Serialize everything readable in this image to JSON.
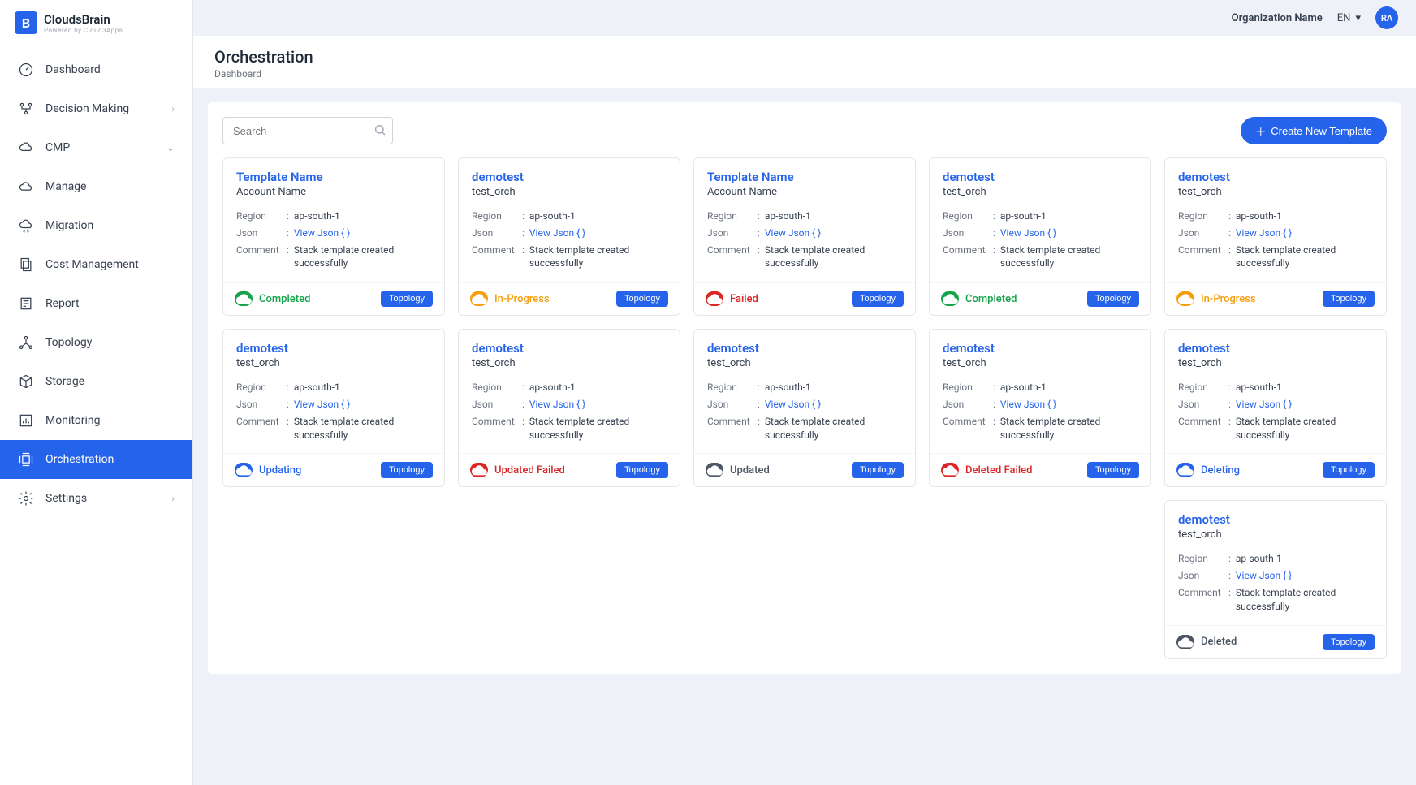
{
  "brand": {
    "name": "CloudsBrain",
    "tagline": "Powered by Cloud3Apps"
  },
  "topbar": {
    "org": "Organization Name",
    "lang": "EN",
    "avatar": "RA"
  },
  "sidebar": {
    "items": [
      {
        "label": "Dashboard",
        "icon": "gauge",
        "expand": null
      },
      {
        "label": "Decision Making",
        "icon": "branch",
        "expand": "right"
      },
      {
        "label": "CMP",
        "icon": "cloud-ring",
        "expand": "down"
      },
      {
        "label": "Manage",
        "icon": "cloud",
        "expand": null
      },
      {
        "label": "Migration",
        "icon": "cloud-arrows",
        "expand": null
      },
      {
        "label": "Cost Management",
        "icon": "docs",
        "expand": null
      },
      {
        "label": "Report",
        "icon": "report",
        "expand": null
      },
      {
        "label": "Topology",
        "icon": "network",
        "expand": null
      },
      {
        "label": "Storage",
        "icon": "box",
        "expand": null
      },
      {
        "label": "Monitoring",
        "icon": "bars",
        "expand": null
      },
      {
        "label": "Orchestration",
        "icon": "frame",
        "expand": null,
        "active": true
      },
      {
        "label": "Settings",
        "icon": "gear",
        "expand": "right"
      }
    ]
  },
  "page": {
    "title": "Orchestration",
    "breadcrumb": "Dashboard"
  },
  "search": {
    "placeholder": "Search"
  },
  "actions": {
    "create": "Create New Template"
  },
  "labels": {
    "region": "Region",
    "json": "Json",
    "comment": "Comment",
    "view_json": "View Json { }",
    "topology": "Topology",
    "sep": ":"
  },
  "cards": [
    {
      "title": "Template Name",
      "account": "Account Name",
      "region": "ap-south-1",
      "comment": "Stack template created successfully",
      "status": "Completed",
      "status_class": "s-completed",
      "icon": "check"
    },
    {
      "title": "demotest",
      "account": "test_orch",
      "region": "ap-south-1",
      "comment": "Stack template created successfully",
      "status": "In-Progress",
      "status_class": "s-inprogress",
      "icon": "sync"
    },
    {
      "title": "Template Name",
      "account": "Account Name",
      "region": "ap-south-1",
      "comment": "Stack template created successfully",
      "status": "Failed",
      "status_class": "s-failed",
      "icon": "x"
    },
    {
      "title": "demotest",
      "account": "test_orch",
      "region": "ap-south-1",
      "comment": "Stack template created successfully",
      "status": "Completed",
      "status_class": "s-completed",
      "icon": "check"
    },
    {
      "title": "demotest",
      "account": "test_orch",
      "region": "ap-south-1",
      "comment": "Stack template created successfully",
      "status": "In-Progress",
      "status_class": "s-inprogress",
      "icon": "sync"
    },
    {
      "title": "demotest",
      "account": "test_orch",
      "region": "ap-south-1",
      "comment": "Stack template created successfully",
      "status": "Updating",
      "status_class": "s-updating",
      "icon": "cloud-sync"
    },
    {
      "title": "demotest",
      "account": "test_orch",
      "region": "ap-south-1",
      "comment": "Stack template created successfully",
      "status": "Updated Failed",
      "status_class": "s-updatedfailed",
      "icon": "cloud-sync"
    },
    {
      "title": "demotest",
      "account": "test_orch",
      "region": "ap-south-1",
      "comment": "Stack template created successfully",
      "status": "Updated",
      "status_class": "s-updated",
      "icon": "cloud-sync"
    },
    {
      "title": "demotest",
      "account": "test_orch",
      "region": "ap-south-1",
      "comment": "Stack template created successfully",
      "status": "Deleted Failed",
      "status_class": "s-deletedfailed",
      "icon": "trash"
    },
    {
      "title": "demotest",
      "account": "test_orch",
      "region": "ap-south-1",
      "comment": "Stack template created successfully",
      "status": "Deleting",
      "status_class": "s-deleting",
      "icon": "trash"
    },
    {
      "title": "demotest",
      "account": "test_orch",
      "region": "ap-south-1",
      "comment": "Stack template created successfully",
      "status": "Deleted",
      "status_class": "s-deleted",
      "icon": "trash",
      "offset": true
    }
  ]
}
